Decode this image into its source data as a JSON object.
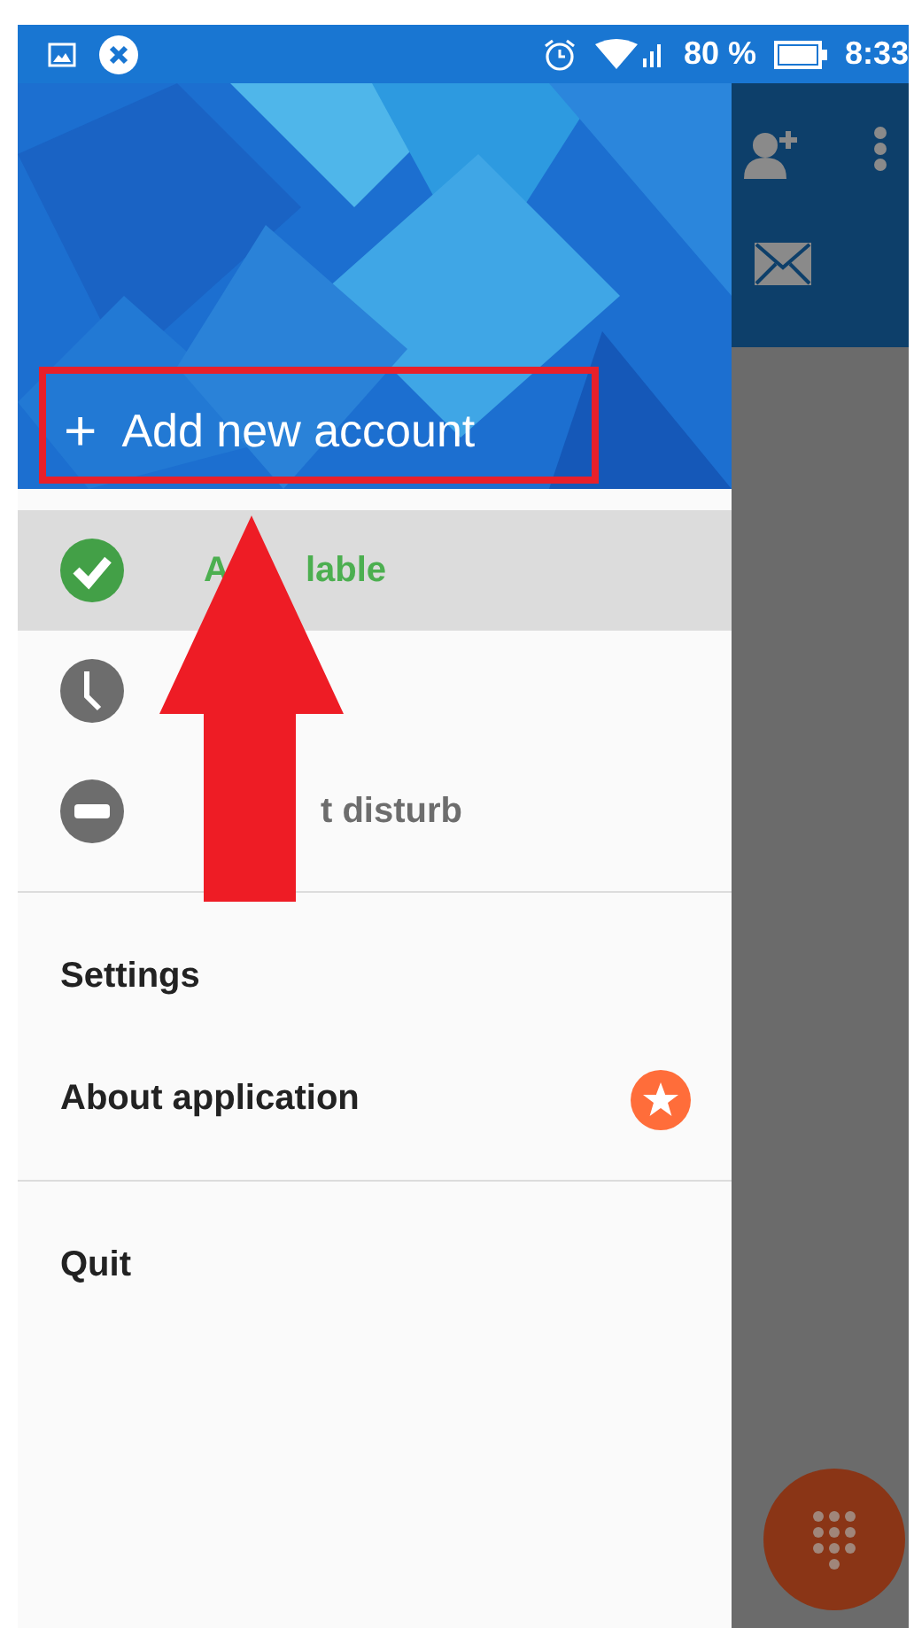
{
  "status_bar": {
    "battery": "80 %",
    "time": "8:33"
  },
  "drawer": {
    "header": {
      "kind": "picture",
      "add_account": "Add new account",
      "add_icon": "+"
    },
    "statuses": [
      {
        "kind": "available",
        "selected": true,
        "label_start": "A",
        "label_end": "lable"
      },
      {
        "kind": "away",
        "selected": false
      },
      {
        "kind": "busy",
        "selected": false,
        "label_end": "t disturb"
      }
    ],
    "menu": [
      {
        "label": "Settings"
      },
      {
        "label": "About application",
        "badge": true
      }
    ],
    "footer": [
      {
        "label": "Quit"
      }
    ]
  },
  "annotations": {
    "highlight_frame": true,
    "arrow": true
  }
}
